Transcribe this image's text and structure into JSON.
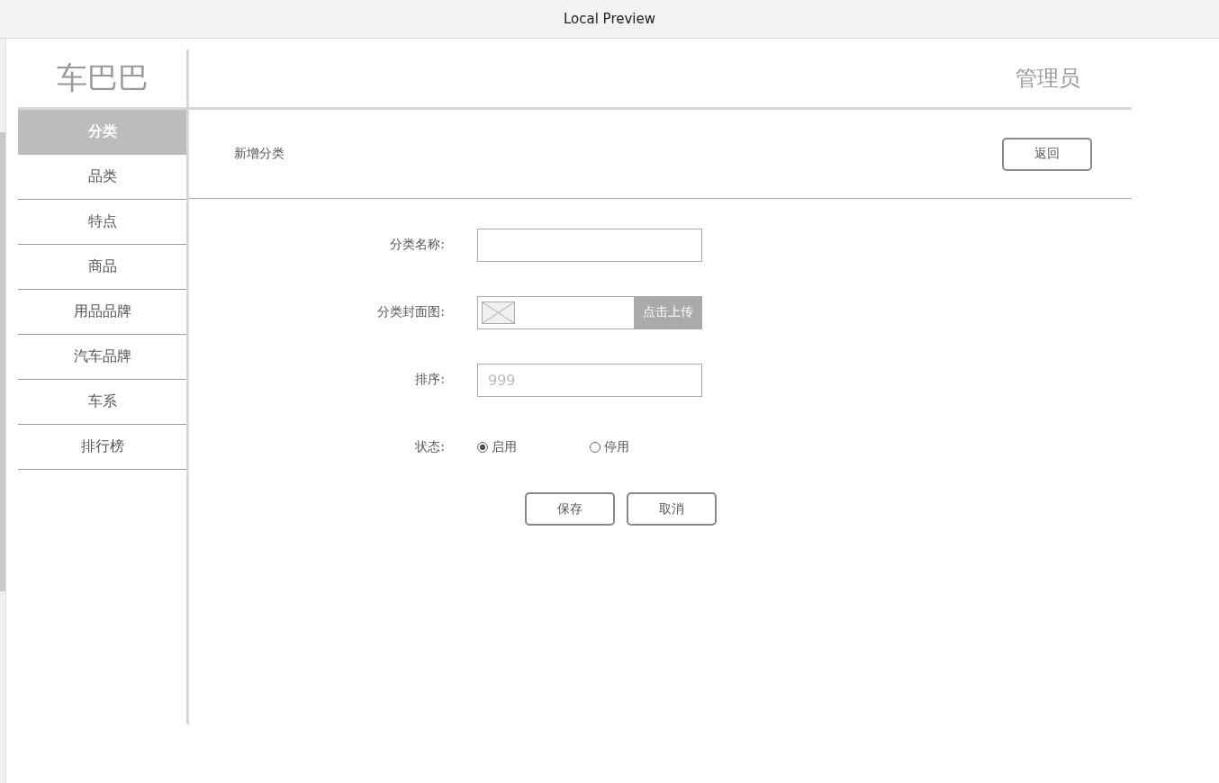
{
  "window": {
    "title": "Local Preview"
  },
  "sidebar": {
    "logo": "车巴巴",
    "items": [
      {
        "label": "分类",
        "selected": true
      },
      {
        "label": "品类",
        "selected": false
      },
      {
        "label": "特点",
        "selected": false
      },
      {
        "label": "商品",
        "selected": false
      },
      {
        "label": "用品品牌",
        "selected": false
      },
      {
        "label": "汽车品牌",
        "selected": false
      },
      {
        "label": "车系",
        "selected": false
      },
      {
        "label": "排行榜",
        "selected": false
      }
    ]
  },
  "header": {
    "user": "管理员"
  },
  "toolbar": {
    "title": "新增分类",
    "back_button": "返回"
  },
  "form": {
    "fields": [
      {
        "kind": "text",
        "label": "分类名称:"
      },
      {
        "kind": "upload",
        "label": "分类封面图:",
        "button": "点击上传"
      },
      {
        "kind": "text",
        "label": "排序:",
        "placeholder": "999"
      },
      {
        "kind": "radio",
        "label": "状态:",
        "options": [
          {
            "label": "启用",
            "selected": true
          },
          {
            "label": "停用",
            "selected": false
          }
        ]
      }
    ],
    "buttons": [
      "保存",
      "取消"
    ]
  }
}
